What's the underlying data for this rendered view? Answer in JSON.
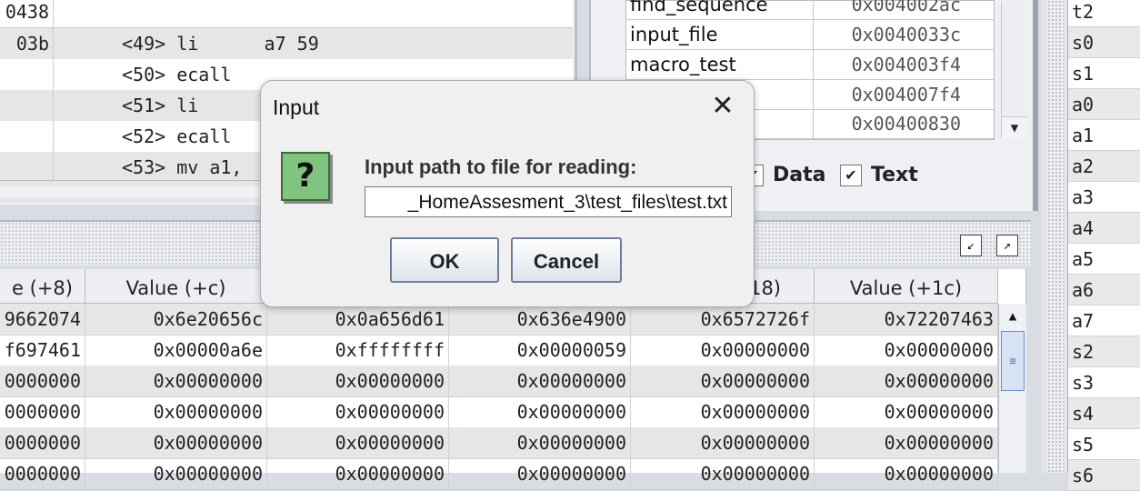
{
  "text_segment": {
    "rows": [
      {
        "addr": "0438",
        "source": ""
      },
      {
        "addr": "03b",
        "source": "<49> li      a7 59"
      },
      {
        "addr": "",
        "source": "<50> ecall"
      },
      {
        "addr": "",
        "source": "<51> li"
      },
      {
        "addr": "",
        "source": "<52> ecall"
      },
      {
        "addr": "",
        "source": "<53> mv a1,"
      }
    ]
  },
  "labels": {
    "rows": [
      {
        "name": "find_sequence",
        "address": "0x004002ac"
      },
      {
        "name": "input_file",
        "address": "0x0040033c"
      },
      {
        "name": "macro_test",
        "address": "0x004003f4"
      },
      {
        "name": "",
        "address": "0x004007f4"
      },
      {
        "name": "",
        "address": "0x00400830"
      }
    ],
    "scroll_down_icon": "triangle-down",
    "checkbox_data": {
      "label": "Data",
      "checked": true
    },
    "checkbox_text": {
      "label": "Text",
      "checked": true
    },
    "check_mark": "✔"
  },
  "registers": [
    "t2",
    "s0",
    "s1",
    "a0",
    "a1",
    "a2",
    "a3",
    "a4",
    "a5",
    "a6",
    "a7",
    "s2",
    "s3",
    "s4",
    "s5",
    "s6"
  ],
  "data_segment": {
    "headers": [
      "e (+8)",
      "Value (+c)",
      "",
      "",
      "18)",
      "Value (+1c)"
    ],
    "rows": [
      [
        "9662074",
        "0x6e20656c",
        "0x0a656d61",
        "0x636e4900",
        "0x6572726f",
        "0x72207463"
      ],
      [
        "f697461",
        "0x00000a6e",
        "0xffffffff",
        "0x00000059",
        "0x00000000",
        "0x00000000"
      ],
      [
        "0000000",
        "0x00000000",
        "0x00000000",
        "0x00000000",
        "0x00000000",
        "0x00000000"
      ],
      [
        "0000000",
        "0x00000000",
        "0x00000000",
        "0x00000000",
        "0x00000000",
        "0x00000000"
      ],
      [
        "0000000",
        "0x00000000",
        "0x00000000",
        "0x00000000",
        "0x00000000",
        "0x00000000"
      ],
      [
        "0000000",
        "0x00000000",
        "0x00000000",
        "0x00000000",
        "0x00000000",
        "0x00000000"
      ]
    ],
    "toolbar_icons": [
      "restore-icon",
      "maximize-icon"
    ]
  },
  "dialog": {
    "title": "Input",
    "close_glyph": "✕",
    "icon_glyph": "?",
    "prompt": "Input path to file for reading:",
    "input_value": "_HomeAssesment_3\\test_files\\test.txt",
    "ok_label": "OK",
    "cancel_label": "Cancel",
    "icon_color": "#7fc37f"
  }
}
